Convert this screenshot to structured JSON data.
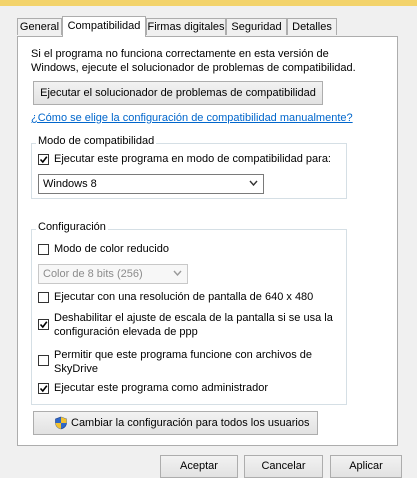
{
  "tabs": [
    {
      "label": "General"
    },
    {
      "label": "Compatibilidad"
    },
    {
      "label": "Firmas digitales"
    },
    {
      "label": "Seguridad"
    },
    {
      "label": "Detalles"
    }
  ],
  "active_tab": "Compatibilidad",
  "intro": {
    "line1": "Si el programa no funciona correctamente en esta versión de",
    "line2": "Windows, ejecute el solucionador de problemas de compatibilidad."
  },
  "troubleshooter_button": "Ejecutar el solucionador de problemas de compatibilidad",
  "manual_link": "¿Cómo se elige la configuración de compatibilidad manualmente?",
  "compat_mode": {
    "title": "Modo de compatibilidad",
    "checkbox_label": "Ejecutar este programa en modo de compatibilidad para:",
    "checked": true,
    "selected_os": "Windows 8"
  },
  "settings": {
    "title": "Configuración",
    "reduced_color": {
      "label": "Modo de color reducido",
      "checked": false
    },
    "color_select": "Color de 8 bits (256)",
    "resolution": {
      "label": "Ejecutar con una resolución de pantalla de 640 x 480",
      "checked": false
    },
    "disable_scaling": {
      "line1": "Deshabilitar el ajuste de escala de la pantalla si se usa la",
      "line2": "configuración elevada de ppp",
      "checked": true
    },
    "skydrive": {
      "line1": "Permitir que este programa funcione con archivos de",
      "line2": "SkyDrive",
      "checked": false
    },
    "admin": {
      "label": "Ejecutar este programa como administrador",
      "checked": true
    }
  },
  "all_users_button": "Cambiar la configuración para todos los usuarios",
  "footer": {
    "accept": "Aceptar",
    "cancel": "Cancelar",
    "apply": "Aplicar"
  },
  "colors": {
    "link": "#0066cc",
    "accent_strip": "#f3d36b"
  }
}
